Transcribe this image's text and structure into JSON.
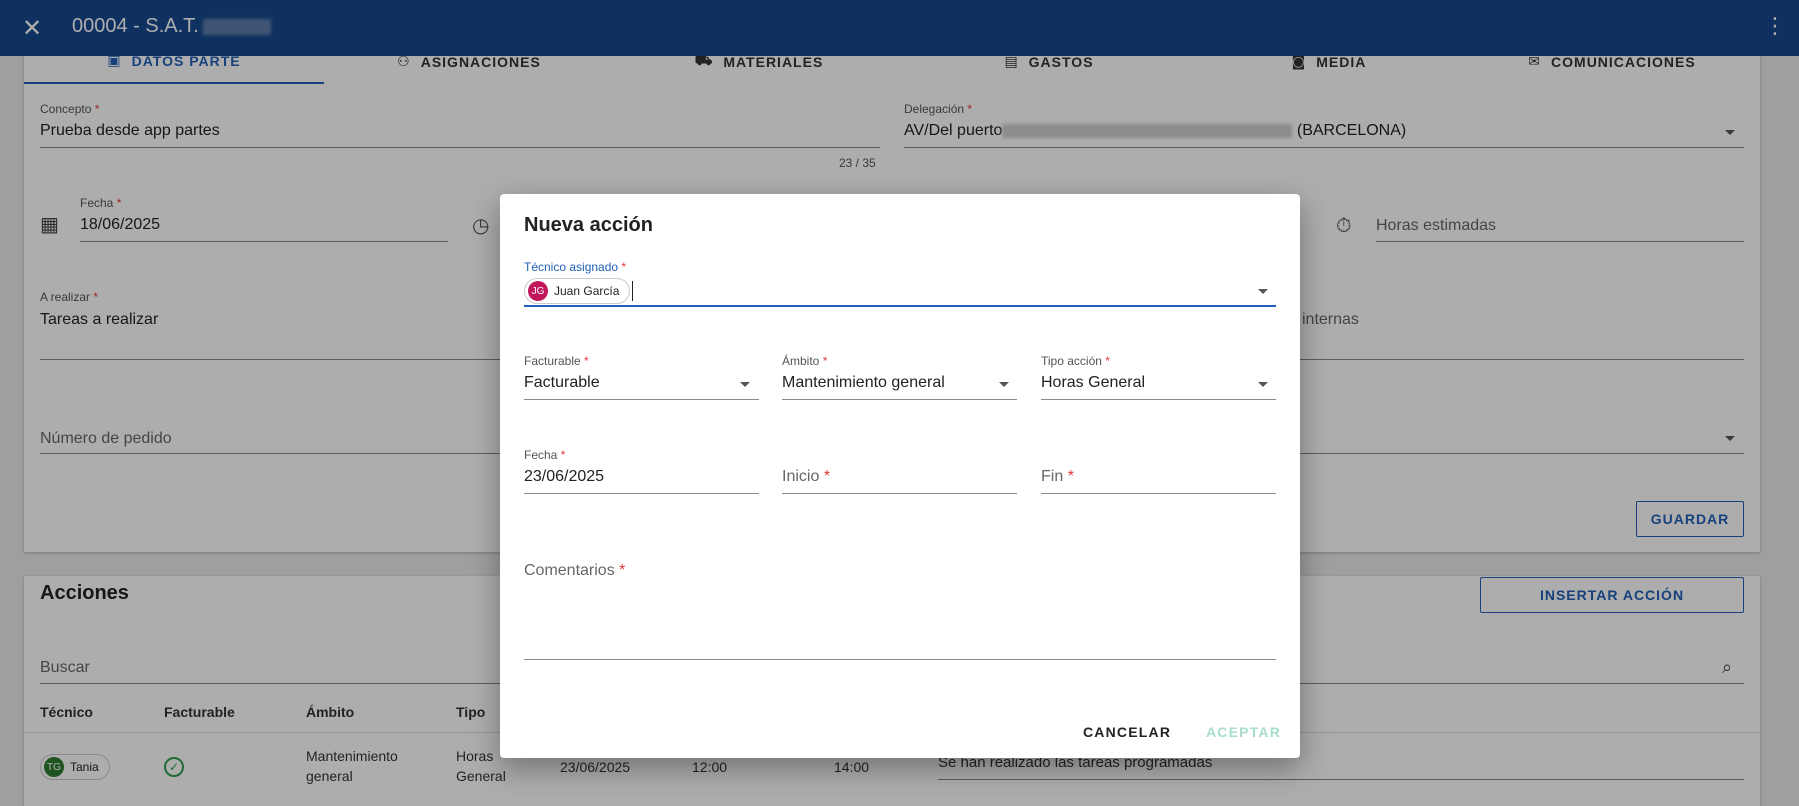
{
  "appbar": {
    "title": "00004 - S.A.T.",
    "close_icon": "close-icon",
    "more_icon": "more-vert-icon"
  },
  "tabs": [
    {
      "label": "DATOS PARTE",
      "icon": "assignment-ind-icon",
      "active": true
    },
    {
      "label": "ASIGNACIONES",
      "icon": "group-icon"
    },
    {
      "label": "MATERIALES",
      "icon": "cart-icon"
    },
    {
      "label": "GASTOS",
      "icon": "receipt-icon"
    },
    {
      "label": "MEDIA",
      "icon": "camera-icon"
    },
    {
      "label": "COMUNICACIONES",
      "icon": "mail-icon"
    }
  ],
  "form": {
    "concepto_label": "Concepto",
    "concepto_value": "Prueba desde app partes",
    "concepto_counter": "23 / 35",
    "delegacion_label": "Delegación",
    "delegacion_value_a": "AV/Del puerto",
    "delegacion_value_b": "(BARCELONA)",
    "fecha_label": "Fecha",
    "fecha_value": "18/06/2025",
    "horas_placeholder": "Horas estimadas",
    "realizar_label": "A realizar",
    "realizar_value": "Tareas a realizar",
    "internas_partial": "internas",
    "pedido_placeholder": "Número de pedido",
    "guardar_label": "GUARDAR"
  },
  "acciones": {
    "title": "Acciones",
    "insertar_label": "INSERTAR ACCIÓN",
    "buscar_placeholder": "Buscar",
    "headers": [
      "Técnico",
      "Facturable",
      "Ámbito",
      "Tipo"
    ],
    "row": {
      "tecnico": "Tania",
      "tecnico_initials": "TG",
      "ambito_1": "Mantenimiento",
      "ambito_2": "general",
      "tipo_1": "Horas",
      "tipo_2": "General",
      "fecha": "23/06/2025",
      "inicio": "12:00",
      "fin": "14:00",
      "comentario": "Se han realizado las tareas programadas"
    }
  },
  "dialog": {
    "title": "Nueva acción",
    "tecnico_label": "Técnico asignado",
    "tecnico_chip": "Juan García",
    "tecnico_initials": "JG",
    "facturable_label": "Facturable",
    "facturable_value": "Facturable",
    "ambito_label": "Ámbito",
    "ambito_value": "Mantenimiento general",
    "tipo_label": "Tipo acción",
    "tipo_value": "Horas General",
    "fecha_label": "Fecha",
    "fecha_value": "23/06/2025",
    "inicio_placeholder": "Inicio",
    "fin_placeholder": "Fin",
    "comentarios_placeholder": "Comentarios",
    "cancel_label": "CANCELAR",
    "accept_label": "ACEPTAR"
  },
  "colors": {
    "primary": "#17498f",
    "accent": "#2260b8",
    "required": "#e23a3a",
    "chip_juan": "#c2185b",
    "chip_tania": "#2e7d32",
    "check": "#2e9e4f"
  }
}
